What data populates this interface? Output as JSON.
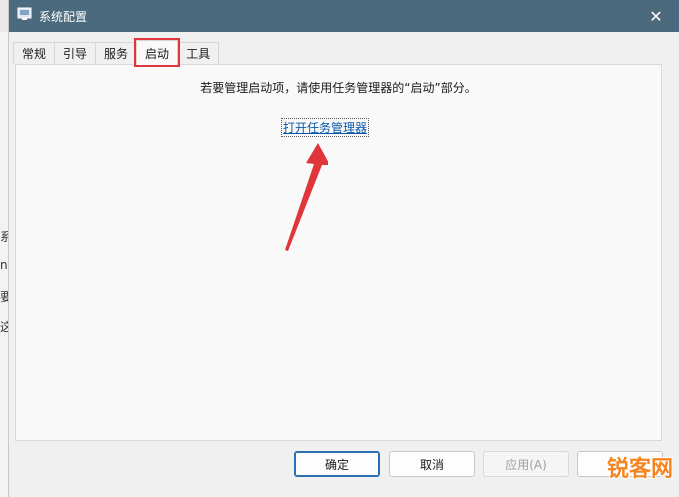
{
  "window": {
    "title": "系统配置",
    "close_glyph": "✕"
  },
  "tabs": [
    {
      "label": "常规",
      "active": false
    },
    {
      "label": "引导",
      "active": false
    },
    {
      "label": "服务",
      "active": false
    },
    {
      "label": "启动",
      "active": true
    },
    {
      "label": "工具",
      "active": false
    }
  ],
  "startup": {
    "info": "若要管理启动项，请使用任务管理器的“启动”部分。",
    "link": "打开任务管理器"
  },
  "buttons": {
    "ok": "确定",
    "cancel": "取消",
    "apply": "应用(A)"
  },
  "background_chars": [
    "系",
    "n",
    "要",
    "这"
  ],
  "watermark": "锐客网",
  "colors": {
    "titlebar": "#4c6a7e",
    "highlight": "#e0353b",
    "link": "#0a56a8",
    "watermark": "#f6851f"
  }
}
